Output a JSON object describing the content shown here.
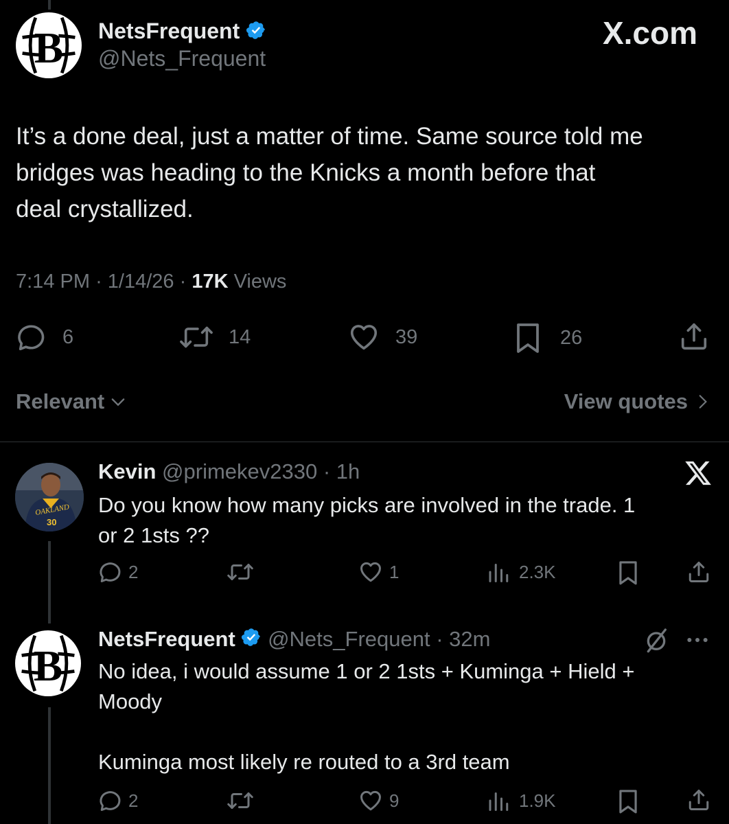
{
  "main_tweet": {
    "display_name": "NetsFrequent",
    "handle": "@Nets_Frequent",
    "watermark": "X.com",
    "text_lines": [
      "It’s a done deal, just a matter of time. Same source told me",
      "bridges was heading to the Knicks a month before that",
      "deal crystallized."
    ],
    "time": "7:14 PM",
    "date": "1/14/26",
    "views_count": "17K",
    "views_label": "Views",
    "replies": "6",
    "reposts": "14",
    "likes": "39",
    "bookmarks": "26"
  },
  "sort": {
    "relevant_label": "Relevant",
    "view_quotes_label": "View quotes"
  },
  "reply1": {
    "display_name": "Kevin",
    "handle": "@primekev2330",
    "time": "· 1h",
    "text_lines": [
      "Do you know how many picks are involved in the trade. 1",
      "or 2 1sts ??"
    ],
    "replies": "2",
    "likes": "1",
    "views": "2.3K",
    "avatar_jersey_text": "OAKLAND",
    "avatar_jersey_number": "30"
  },
  "reply2": {
    "display_name": "NetsFrequent",
    "handle": "@Nets_Frequent",
    "time": "· 32m",
    "text_lines": [
      "No idea, i would assume 1 or 2 1sts + Kuminga + Hield +",
      "Moody",
      "",
      "Kuminga most likely re routed to a 3rd team"
    ],
    "replies": "2",
    "likes": "9",
    "views": "1.9K"
  },
  "colors": {
    "background": "#000000",
    "text": "#e7e9ea",
    "muted": "#71767b",
    "verified": "#1d9bf0",
    "divider": "#2f3336"
  }
}
